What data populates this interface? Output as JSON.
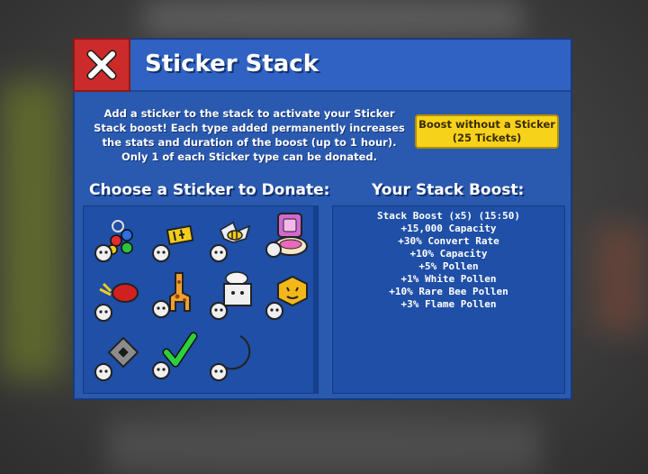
{
  "window": {
    "title": "Sticker Stack",
    "description": "Add a sticker to the stack to activate your Sticker Stack boost! Each type added permanently increases the stats and duration of the boost (up to 1 hour). Only 1 of each Sticker type can be donated.",
    "boost_button": {
      "line1": "Boost without a Sticker",
      "line2": "(25 Tickets)"
    }
  },
  "donate": {
    "title": "Choose a Sticker to Donate:",
    "stickers": [
      {
        "icon": "colored-dots-sticker-icon"
      },
      {
        "icon": "yellow-letters-sticker-icon"
      },
      {
        "icon": "paper-bee-sticker-icon"
      },
      {
        "icon": "pink-pot-sticker-icon"
      },
      {
        "icon": "red-can-sticker-icon"
      },
      {
        "icon": "giraffe-sticker-icon"
      },
      {
        "icon": "chef-cube-sticker-icon"
      },
      {
        "icon": "hexagon-face-sticker-icon"
      },
      {
        "icon": "gray-diamond-sticker-icon"
      },
      {
        "icon": "green-check-sticker-icon"
      },
      {
        "icon": "moon-sticker-icon"
      }
    ]
  },
  "boost": {
    "title": "Your Stack Boost:",
    "lines": [
      "Stack Boost (x5) (15:50)",
      "+15,000 Capacity",
      "+30% Convert Rate",
      "+10% Capacity",
      "+5% Pollen",
      "+1% White Pollen",
      "+10% Rare Bee Pollen",
      "+3% Flame Pollen"
    ]
  },
  "colors": {
    "panel": "#2a5ab0",
    "title_bar": "#2f62c2",
    "close": "#cc2b2b",
    "boost_button": "#f6d21a"
  }
}
